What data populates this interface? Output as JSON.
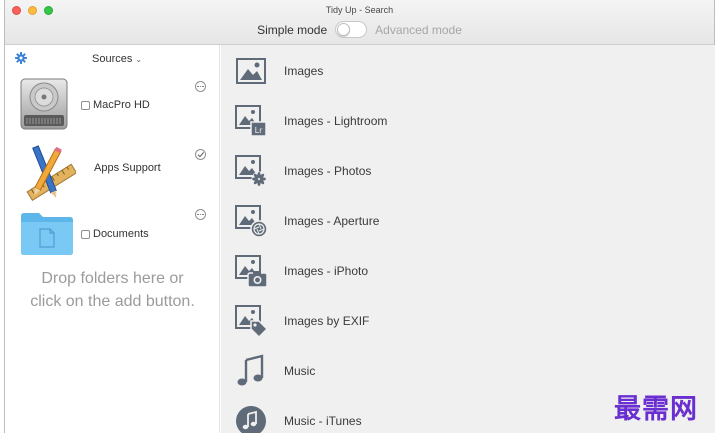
{
  "window": {
    "title": "Tidy Up - Search"
  },
  "mode": {
    "simple_label": "Simple mode",
    "advanced_label": "Advanced mode",
    "advanced_on": false
  },
  "sidebar": {
    "sources_label": "Sources",
    "items": [
      {
        "label": "MacPro HD",
        "icon": "hard-drive-icon",
        "checkbox": true,
        "action_icon": "more-icon"
      },
      {
        "label": "Apps Support",
        "icon": "apps-support-icon",
        "checkbox": false,
        "action_icon": "checkmark-icon"
      },
      {
        "label": "Documents",
        "icon": "folder-icon",
        "checkbox": true,
        "action_icon": "more-icon"
      }
    ],
    "drop_hint_line1": "Drop folders here or",
    "drop_hint_line2": "click on the add button."
  },
  "main": {
    "rows": [
      {
        "label": "Images",
        "icon": "image-icon"
      },
      {
        "label": "Images - Lightroom",
        "icon": "image-lightroom-icon"
      },
      {
        "label": "Images - Photos",
        "icon": "image-photos-icon"
      },
      {
        "label": "Images - Aperture",
        "icon": "image-aperture-icon"
      },
      {
        "label": "Images - iPhoto",
        "icon": "image-iphoto-icon"
      },
      {
        "label": "Images by EXIF",
        "icon": "image-exif-icon"
      },
      {
        "label": "Music",
        "icon": "music-note-icon"
      },
      {
        "label": "Music - iTunes",
        "icon": "itunes-icon"
      }
    ]
  },
  "watermark": "最需网",
  "colors": {
    "accent": "#3b82d6",
    "main_bg": "#f0f0f0",
    "icon_gray": "#5f6b78",
    "watermark": "#6a2fd0"
  }
}
